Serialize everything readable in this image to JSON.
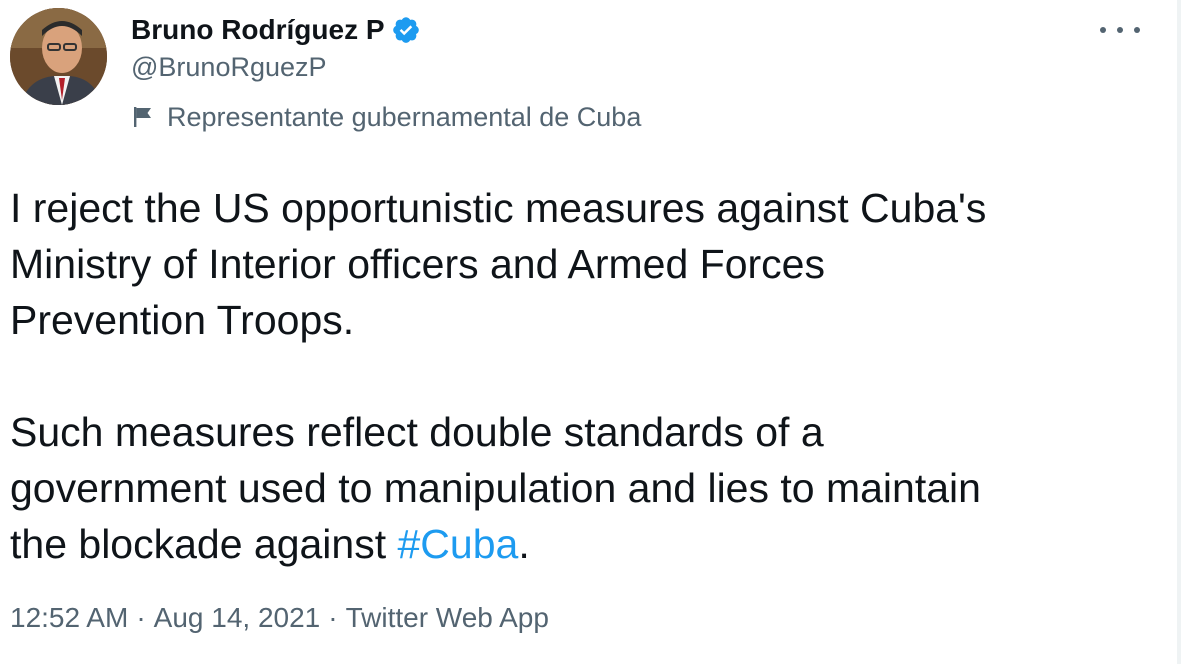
{
  "author": {
    "display_name": "Bruno Rodríguez P",
    "handle": "@BrunoRguezP",
    "label": "Representante gubernamental de Cuba",
    "avatar_icon": "profile-photo",
    "verified_icon": "verified-badge-icon",
    "verified_color": "#1d9bf0"
  },
  "tweet": {
    "paragraph1_lines": [
      "I reject the US opportunistic measures against Cuba's",
      "Ministry of Interior officers and Armed Forces",
      "Prevention Troops."
    ],
    "paragraph2_lines": [
      "Such measures reflect double standards of a",
      "government used to manipulation and lies to maintain"
    ],
    "paragraph2_last_prefix": "the blockade against ",
    "hashtag": "#Cuba",
    "paragraph2_last_suffix": "."
  },
  "meta": {
    "time": "12:52 AM",
    "separator": "·",
    "date": "Aug 14, 2021",
    "source": "Twitter Web App"
  },
  "colors": {
    "text": "#0f1419",
    "secondary": "#536471",
    "link": "#1d9bf0"
  }
}
